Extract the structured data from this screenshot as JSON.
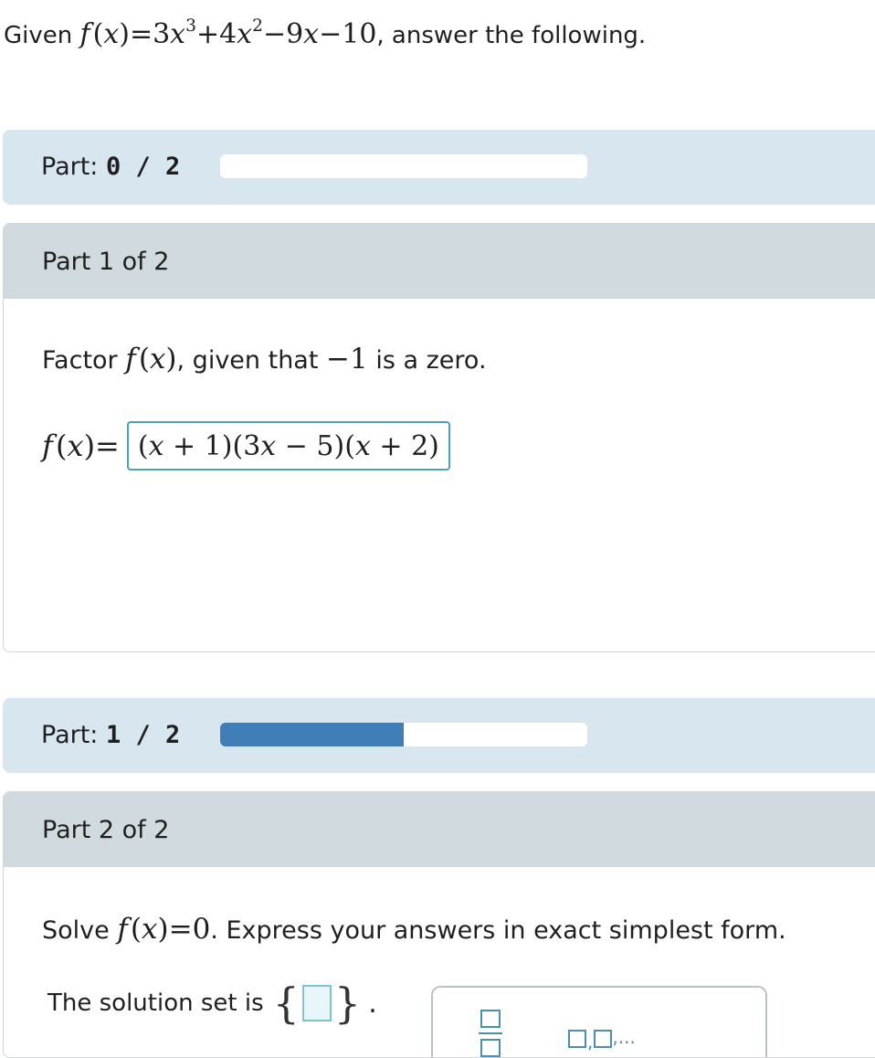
{
  "problem": {
    "prefix": "Given",
    "function": "f(x) = 3x³ + 4x² − 9x − 10",
    "suffix": ", answer the following."
  },
  "progress": [
    {
      "label": "Part:",
      "value": "0 / 2",
      "fraction": 0.0
    },
    {
      "label": "Part:",
      "value": "1 / 2",
      "fraction": 0.5
    }
  ],
  "part1": {
    "header": "Part 1 of 2",
    "prompt_prefix": "Factor",
    "prompt_func": "f(x)",
    "prompt_mid": ", given that",
    "prompt_zero": "−1",
    "prompt_suffix": "is a zero.",
    "answer_lhs": "f(x) =",
    "answer_value": "(x + 1)(3x − 5)(x + 2)"
  },
  "part2": {
    "header": "Part 2 of 2",
    "prompt_prefix": "Solve",
    "prompt_equation": "f(x) = 0",
    "prompt_suffix": ". Express your answers in exact simplest form.",
    "solution_label": "The solution set is",
    "period": ".",
    "palette_list_suffix": ",..."
  }
}
